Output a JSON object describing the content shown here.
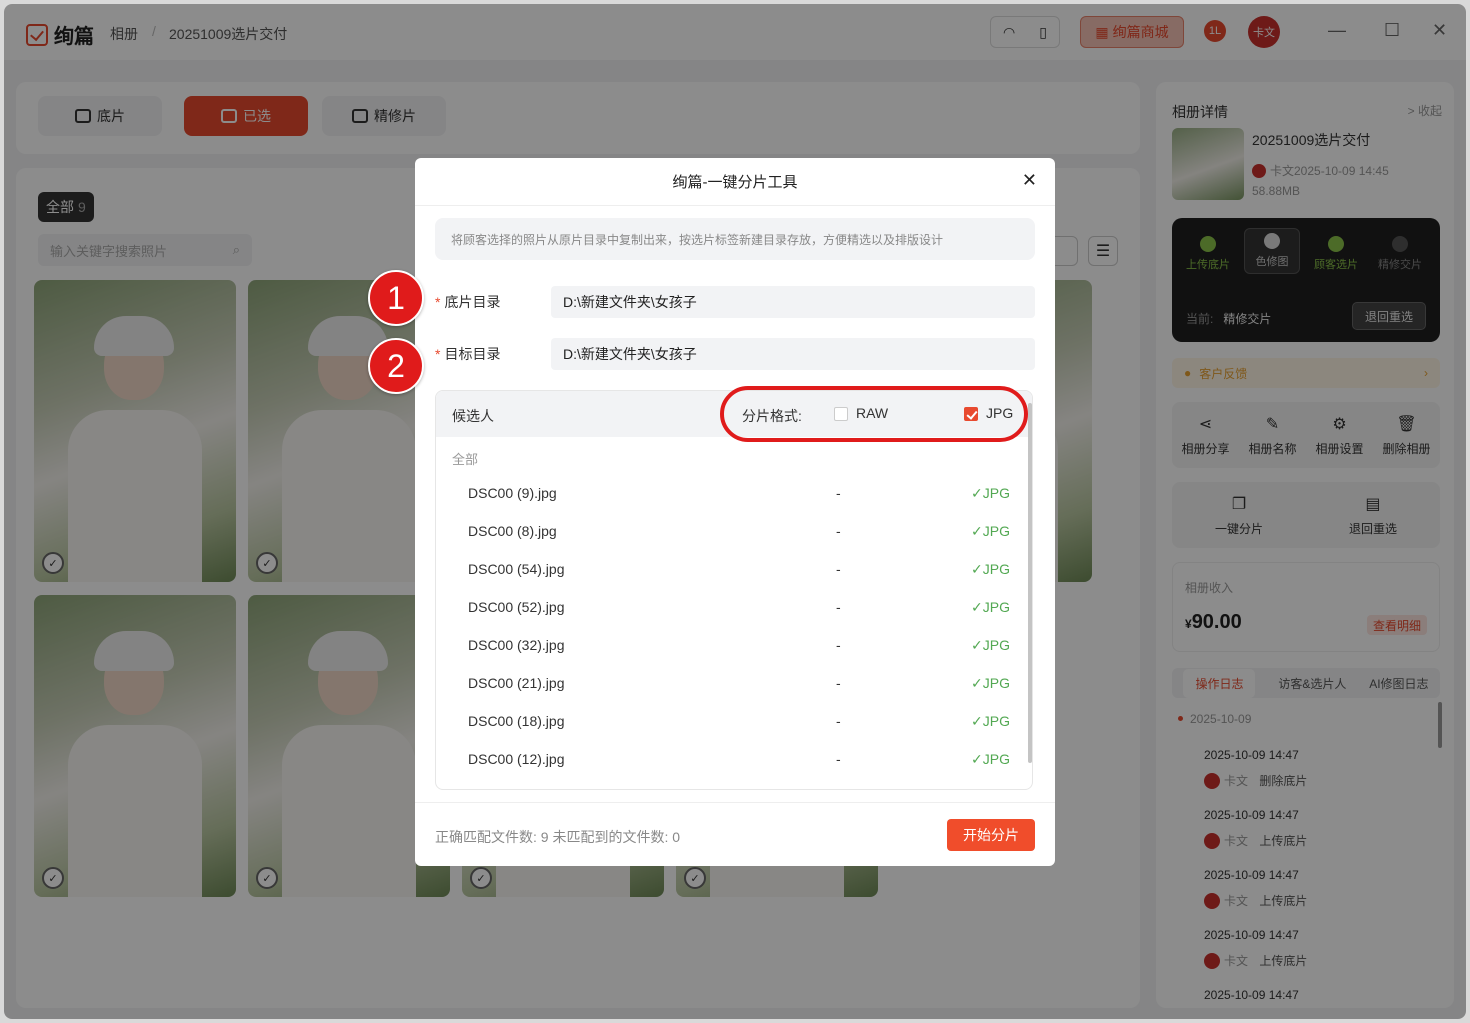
{
  "app": {
    "logo_text": "绚篇",
    "breadcrumb": [
      "相册",
      "20251009选片交付"
    ],
    "shop_label": "绚篇商城",
    "notif_count": "1L",
    "avatar_text": "卡文"
  },
  "tabs": [
    {
      "label": "底片",
      "active": false
    },
    {
      "label": "已选",
      "active": true
    },
    {
      "label": "精修片",
      "active": false
    }
  ],
  "main": {
    "all_label": "全部",
    "all_count": "9",
    "search_placeholder": "输入关键字搜索照片"
  },
  "sidebar": {
    "title": "相册详情",
    "collapse": "收起",
    "album_name": "20251009选片交付",
    "album_meta": "卡文2025-10-09 14:45",
    "album_size": "58.88MB",
    "steps": [
      "上传底片",
      "色修图",
      "顾客选片",
      "精修交片"
    ],
    "current_label": "当前:",
    "current_value": "精修交片",
    "back_btn": "退回重选",
    "feedback": "客户反馈",
    "actions": [
      "相册分享",
      "相册名称",
      "相册设置",
      "删除相册"
    ],
    "actions2": [
      "一键分片",
      "退回重选"
    ],
    "income_label": "相册收入",
    "income_currency": "¥",
    "income_value": "90.00",
    "income_detail": "查看明细",
    "log_tabs": [
      "操作日志",
      "访客&选片人",
      "AI修图日志"
    ],
    "log_date": "2025-10-09",
    "logs": [
      {
        "time": "2025-10-09 14:47",
        "user": "卡文",
        "action": "删除底片"
      },
      {
        "time": "2025-10-09 14:47",
        "user": "卡文",
        "action": "上传底片"
      },
      {
        "time": "2025-10-09 14:47",
        "user": "卡文",
        "action": "上传底片"
      },
      {
        "time": "2025-10-09 14:47",
        "user": "卡文",
        "action": "上传底片"
      },
      {
        "time": "2025-10-09 14:47",
        "user": "",
        "action": ""
      }
    ]
  },
  "dialog": {
    "title": "绚篇-一键分片工具",
    "tip": "将顾客选择的照片从原片目录中复制出来，按选片标签新建目录存放，方便精选以及排版设计",
    "source_label": "底片目录",
    "source_value": "D:\\新建文件夹\\女孩子",
    "target_label": "目标目录",
    "target_value": "D:\\新建文件夹\\女孩子",
    "candidate_label": "候选人",
    "format_label": "分片格式:",
    "raw_label": "RAW",
    "raw_checked": false,
    "jpg_label": "JPG",
    "jpg_checked": true,
    "group_label": "全部",
    "files": [
      {
        "name": "DSC00 (9).jpg",
        "dash": "-",
        "fmt": "✓JPG"
      },
      {
        "name": "DSC00 (8).jpg",
        "dash": "-",
        "fmt": "✓JPG"
      },
      {
        "name": "DSC00 (54).jpg",
        "dash": "-",
        "fmt": "✓JPG"
      },
      {
        "name": "DSC00 (52).jpg",
        "dash": "-",
        "fmt": "✓JPG"
      },
      {
        "name": "DSC00 (32).jpg",
        "dash": "-",
        "fmt": "✓JPG"
      },
      {
        "name": "DSC00 (21).jpg",
        "dash": "-",
        "fmt": "✓JPG"
      },
      {
        "name": "DSC00 (18).jpg",
        "dash": "-",
        "fmt": "✓JPG"
      },
      {
        "name": "DSC00 (12).jpg",
        "dash": "-",
        "fmt": "✓JPG"
      }
    ],
    "footer": "正确匹配文件数: 9 未匹配到的文件数: 0",
    "start_btn": "开始分片"
  },
  "annotations": [
    "1",
    "2"
  ]
}
